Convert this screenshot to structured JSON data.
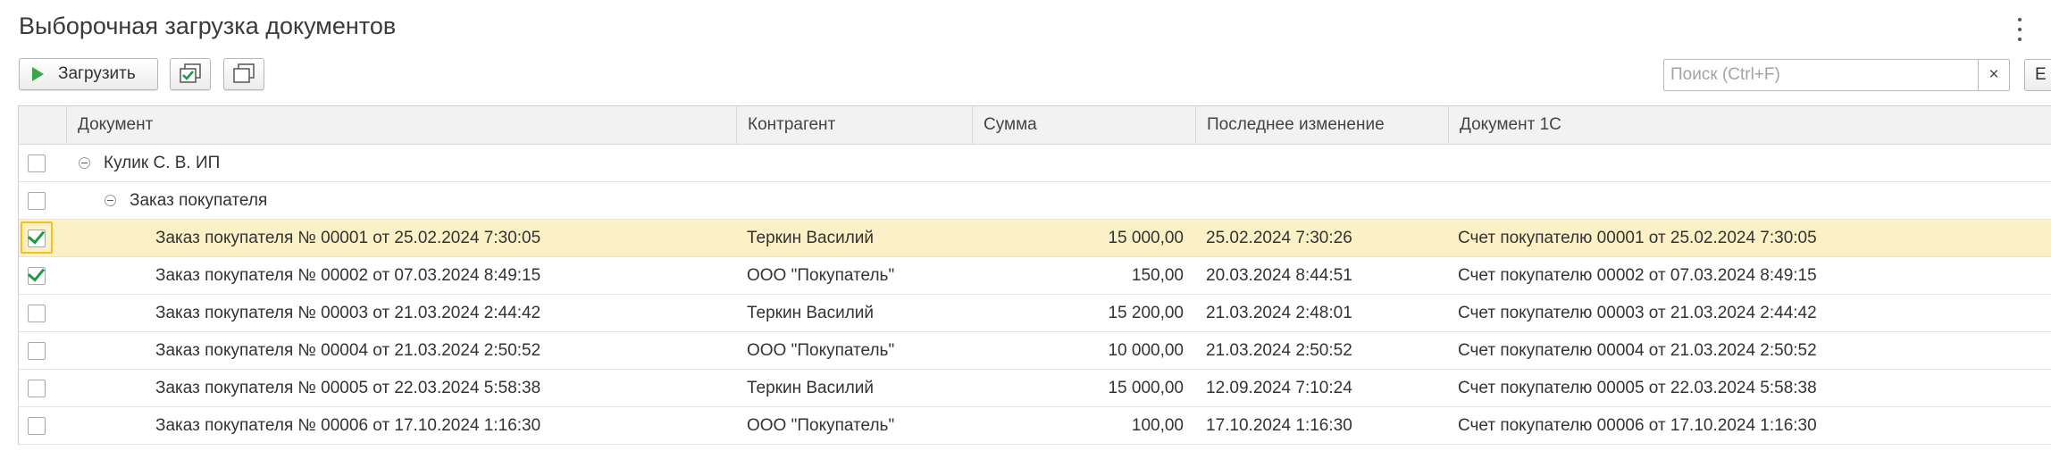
{
  "window": {
    "title": "Выборочная загрузка документов"
  },
  "toolbar": {
    "load_label": "Загрузить",
    "check_all_icon": "check-all-icon",
    "uncheck_all_icon": "uncheck-all-icon",
    "search_placeholder": "Поиск (Ctrl+F)",
    "search_value": "",
    "clear_label": "×",
    "extra_label": "Е"
  },
  "table": {
    "columns": [
      "Документ",
      "Контрагент",
      "Сумма",
      "Последнее изменение",
      "Документ 1С"
    ],
    "groups": [
      {
        "label": "Кулик С. В. ИП",
        "level": 0
      },
      {
        "label": "Заказ покупателя",
        "level": 1
      }
    ],
    "rows": [
      {
        "checked": true,
        "selected": true,
        "document": "Заказ покупателя № 00001 от 25.02.2024 7:30:05",
        "counterparty": "Теркин Василий",
        "amount": "15 000,00",
        "modified": "25.02.2024 7:30:26",
        "doc1c": "Счет покупателю 00001 от 25.02.2024 7:30:05"
      },
      {
        "checked": true,
        "selected": false,
        "document": "Заказ покупателя № 00002 от 07.03.2024 8:49:15",
        "counterparty": "ООО \"Покупатель\"",
        "amount": "150,00",
        "modified": "20.03.2024 8:44:51",
        "doc1c": "Счет покупателю 00002 от 07.03.2024 8:49:15"
      },
      {
        "checked": false,
        "selected": false,
        "document": "Заказ покупателя № 00003 от 21.03.2024 2:44:42",
        "counterparty": "Теркин Василий",
        "amount": "15 200,00",
        "modified": "21.03.2024 2:48:01",
        "doc1c": "Счет покупателю 00003 от 21.03.2024 2:44:42"
      },
      {
        "checked": false,
        "selected": false,
        "document": "Заказ покупателя № 00004 от 21.03.2024 2:50:52",
        "counterparty": "ООО \"Покупатель\"",
        "amount": "10 000,00",
        "modified": "21.03.2024 2:50:52",
        "doc1c": "Счет покупателю 00004 от 21.03.2024 2:50:52"
      },
      {
        "checked": false,
        "selected": false,
        "document": "Заказ покупателя № 00005 от 22.03.2024 5:58:38",
        "counterparty": "Теркин Василий",
        "amount": "15 000,00",
        "modified": "12.09.2024 7:10:24",
        "doc1c": "Счет покупателю 00005 от 22.03.2024 5:58:38"
      },
      {
        "checked": false,
        "selected": false,
        "document": "Заказ покупателя № 00006 от 17.10.2024 1:16:30",
        "counterparty": "ООО \"Покупатель\"",
        "amount": "100,00",
        "modified": "17.10.2024 1:16:30",
        "doc1c": "Счет покупателю 00006 от 17.10.2024 1:16:30"
      }
    ]
  },
  "colors": {
    "accent_check": "#1f9a45",
    "selected_row": "#fcf0c6",
    "focus_border": "#f2c11d",
    "play_icon": "#3aa64a"
  }
}
